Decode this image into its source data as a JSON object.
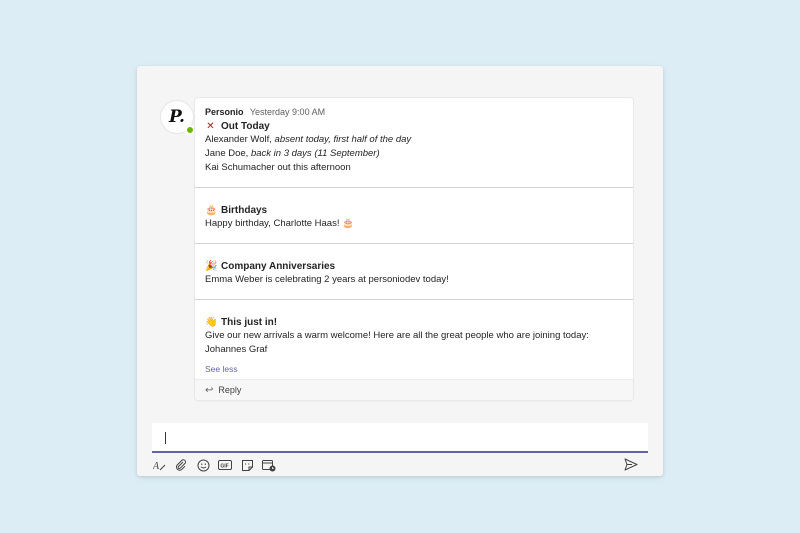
{
  "message": {
    "sender": "Personio",
    "timestamp": "Yesterday 9:00 AM",
    "avatar_letter": "P.",
    "presence": "available",
    "sections": [
      {
        "icon": "cross-mark-icon",
        "title": "Out Today",
        "lines": [
          {
            "text": "Alexander Wolf, ",
            "italic": "absent today, first half of the day"
          },
          {
            "text": "Jane Doe, ",
            "italic": "back in 3 days (11 September)"
          },
          {
            "text": "Kai Schumacher out this afternoon",
            "italic": ""
          }
        ]
      },
      {
        "icon": "cake-icon",
        "title": "Birthdays",
        "lines": [
          {
            "text": "Happy birthday, Charlotte Haas! 🎂",
            "italic": ""
          }
        ]
      },
      {
        "icon": "party-popper-icon",
        "title": "Company Anniversaries",
        "lines": [
          {
            "text": "Emma Weber is celebrating 2 years at personiodev today!",
            "italic": ""
          }
        ]
      },
      {
        "icon": "waving-hand-icon",
        "title": "This just in!",
        "lines": [
          {
            "text": "Give our new arrivals a warm welcome! Here are all the great people who are joining today:",
            "italic": ""
          },
          {
            "text": "Johannes Graf",
            "italic": ""
          }
        ]
      }
    ],
    "see_less": "See less",
    "reply": "Reply"
  },
  "compose": {
    "value": "",
    "toolbar": [
      "format-icon",
      "attach-icon",
      "emoji-icon",
      "gif-icon",
      "sticker-icon",
      "schedule-meeting-icon"
    ],
    "send": "send-icon"
  },
  "colors": {
    "background": "#dcedf5",
    "accent": "#6264a7",
    "presence": "#6bb700",
    "cross": "#c50f1f"
  }
}
